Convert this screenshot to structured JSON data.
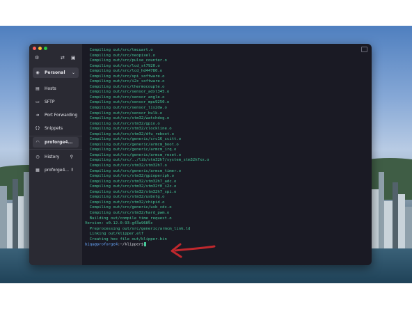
{
  "sidebar": {
    "vault_label": "Personal",
    "nav": [
      {
        "label": "Hosts",
        "icon": "server-icon"
      },
      {
        "label": "SFTP",
        "icon": "folder-icon"
      },
      {
        "label": "Port Forwarding",
        "icon": "arrow-right-icon"
      },
      {
        "label": "Snippets",
        "icon": "braces-icon"
      }
    ],
    "active_host": "proforge4...",
    "history_label": "History",
    "history_item": "proforge4...",
    "history_alert": "!"
  },
  "terminal": {
    "lines": [
      "  Compiling out/src/tmcuart.o",
      "  Compiling out/src/neopixel.o",
      "  Compiling out/src/pulse_counter.o",
      "  Compiling out/src/lcd_st7920.o",
      "  Compiling out/src/lcd_hd44780.o",
      "  Compiling out/src/spi_software.o",
      "  Compiling out/src/i2c_software.o",
      "  Compiling out/src/thermocouple.o",
      "  Compiling out/src/sensor_adxl345.o",
      "  Compiling out/src/sensor_angle.o",
      "  Compiling out/src/sensor_mpu9250.o",
      "  Compiling out/src/sensor_lis2dw.o",
      "  Compiling out/src/sensor_bulk.o",
      "  Compiling out/src/stm32/watchdog.o",
      "  Compiling out/src/stm32/gpio.o",
      "  Compiling out/src/stm32/clockline.o",
      "  Compiling out/src/stm32/dfu_reboot.o",
      "  Compiling out/src/generic/crc16_ccitt.o",
      "  Compiling out/src/generic/armcm_boot.o",
      "  Compiling out/src/generic/armcm_irq.o",
      "  Compiling out/src/generic/armcm_reset.o",
      "  Compiling out/src/../lib/stm32h7/system_stm32h7xx.o",
      "  Compiling out/src/stm32/stm32h7.o",
      "  Compiling out/src/generic/armcm_timer.o",
      "  Compiling out/src/stm32/gpioperiph.o",
      "  Compiling out/src/stm32/stm32h7_adc.o",
      "  Compiling out/src/stm32/stm32f0_i2c.o",
      "  Compiling out/src/stm32/stm32h7_spi.o",
      "  Compiling out/src/stm32/usbotg.o",
      "  Compiling out/src/stm32/chipid.o",
      "  Compiling out/src/generic/usb_cdc.o",
      "  Compiling out/src/stm32/hard_pwm.o",
      "  Building out/compile_time_request.o",
      "Version: v0.12.0-93-g43a9685c",
      "  Preprocessing out/src/generic/armcm_link.ld",
      "  Linking out/klipper.elf",
      "  Creating hex file out/klipper.bin"
    ],
    "prompt_user": "biqu@proforge4",
    "prompt_rest": ":~/klipper$"
  },
  "colors": {
    "terminal_bg": "#1a1a24",
    "sidebar_bg": "#2a2a33",
    "output_green": "#46c99a",
    "prompt_blue": "#6aa9ff",
    "annotation_red": "#c0282d"
  }
}
